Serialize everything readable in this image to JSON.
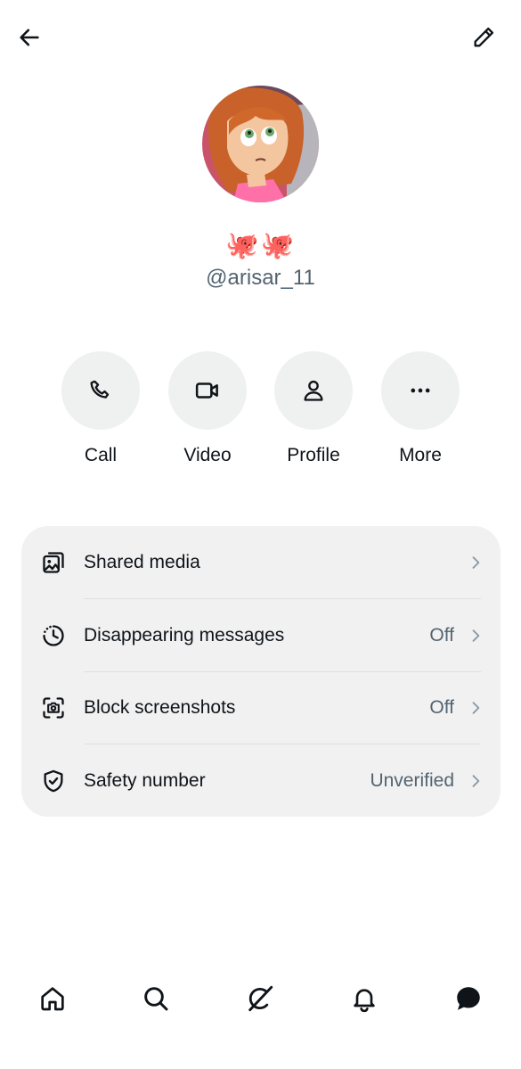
{
  "header": {
    "back_icon": "arrow-left-icon",
    "edit_icon": "pencil-icon"
  },
  "profile": {
    "avatar": "cartoon-avatar",
    "display_name": "🐙🐙",
    "handle": "@arisar_11"
  },
  "actions": [
    {
      "label": "Call",
      "icon": "phone-icon"
    },
    {
      "label": "Video",
      "icon": "video-camera-icon"
    },
    {
      "label": "Profile",
      "icon": "person-icon"
    },
    {
      "label": "More",
      "icon": "more-dots-icon"
    }
  ],
  "settings": [
    {
      "label": "Shared media",
      "value": "",
      "icon": "media-gallery-icon"
    },
    {
      "label": "Disappearing messages",
      "value": "Off",
      "icon": "timer-icon"
    },
    {
      "label": "Block screenshots",
      "value": "Off",
      "icon": "screenshot-camera-icon"
    },
    {
      "label": "Safety number",
      "value": "Unverified",
      "icon": "shield-check-icon"
    }
  ],
  "bottom_nav": [
    {
      "name": "home",
      "icon": "home-icon"
    },
    {
      "name": "search",
      "icon": "search-icon"
    },
    {
      "name": "grok",
      "icon": "grok-icon"
    },
    {
      "name": "notifications",
      "icon": "bell-icon"
    },
    {
      "name": "messages",
      "icon": "message-bubble-icon",
      "active": true
    }
  ],
  "colors": {
    "text_primary": "#0f1419",
    "text_secondary": "#536471",
    "surface": "#f1f1f1",
    "action_bg": "#eff0f0"
  }
}
